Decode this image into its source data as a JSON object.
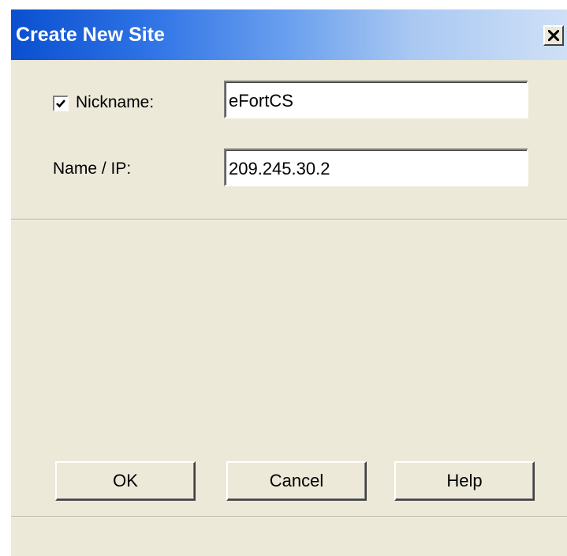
{
  "window": {
    "title": "Create New Site",
    "close_glyph": "×",
    "title_gradient_colors": [
      "#0a4fd0",
      "#cfe0f7"
    ]
  },
  "form": {
    "nickname_checked": true,
    "nickname_label": "Nickname:",
    "nickname_value": "eFortCS",
    "name_ip_label": "Name / IP:",
    "name_ip_value": "209.245.30.2"
  },
  "buttons": {
    "ok_label": "OK",
    "cancel_label": "Cancel",
    "help_label": "Help"
  },
  "icons": {
    "checkbox": "checkmark-icon",
    "close": "close-icon"
  }
}
